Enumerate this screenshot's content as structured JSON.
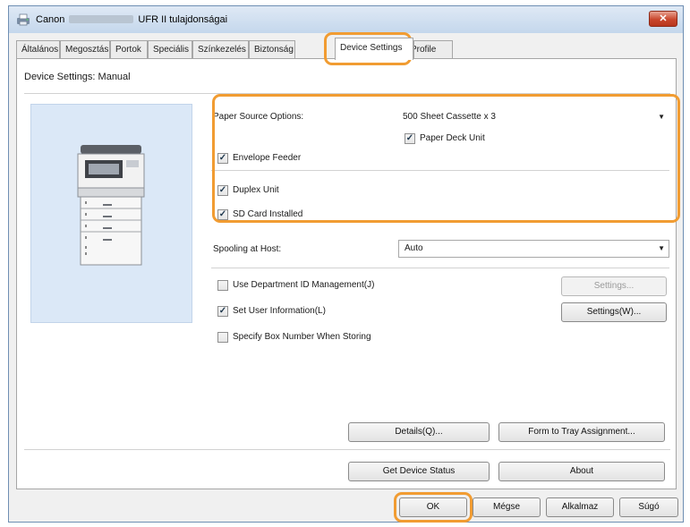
{
  "window": {
    "title_prefix": "Canon",
    "title_suffix": "UFR II tulajdonságai",
    "close_label": "✕"
  },
  "tabs": [
    {
      "label": "Általános"
    },
    {
      "label": "Megosztás"
    },
    {
      "label": "Portok"
    },
    {
      "label": "Speciális"
    },
    {
      "label": "Színkezelés"
    },
    {
      "label": "Biztonság"
    },
    {
      "label": "Device Settings"
    },
    {
      "label": "Profile"
    }
  ],
  "active_tab": "Device Settings",
  "panel": {
    "title": "Device Settings: Manual",
    "paper_source_label": "Paper Source Options:",
    "paper_source_value": "500 Sheet Cassette x 3",
    "paper_deck": {
      "label": "Paper Deck Unit",
      "checked": true
    },
    "envelope_feeder": {
      "label": "Envelope Feeder",
      "checked": true
    },
    "duplex_unit": {
      "label": "Duplex Unit",
      "checked": true
    },
    "sd_card": {
      "label": "SD Card Installed",
      "checked": true
    },
    "spooling_label": "Spooling at Host:",
    "spooling_value": "Auto",
    "dept_id": {
      "label": "Use Department ID Management(J)",
      "checked": false
    },
    "dept_settings_button": "Settings...",
    "user_info": {
      "label": "Set User Information(L)",
      "checked": true
    },
    "user_settings_button": "Settings(W)...",
    "box_number": {
      "label": "Specify Box Number When Storing",
      "checked": false
    },
    "details_button": "Details(Q)...",
    "form_tray_button": "Form to Tray Assignment...",
    "device_status_button": "Get Device Status",
    "about_button": "About"
  },
  "footer": {
    "ok": "OK",
    "cancel": "Mégse",
    "apply": "Alkalmaz",
    "help": "Súgó"
  },
  "colors": {
    "highlight": "#f19c32",
    "preview_bg": "#dbe8f7"
  }
}
